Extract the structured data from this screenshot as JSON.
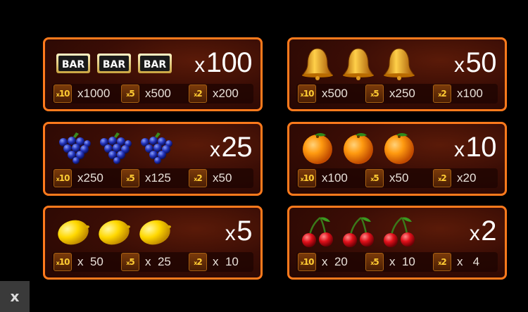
{
  "paytable": [
    {
      "symbol": "bar-icon",
      "multiplier": "100",
      "bonus": [
        {
          "badge": "10",
          "value": "x1000"
        },
        {
          "badge": "5",
          "value": "x500"
        },
        {
          "badge": "2",
          "value": "x200"
        }
      ]
    },
    {
      "symbol": "bell-icon",
      "multiplier": "50",
      "bonus": [
        {
          "badge": "10",
          "value": "x500"
        },
        {
          "badge": "5",
          "value": "x250"
        },
        {
          "badge": "2",
          "value": "x100"
        }
      ]
    },
    {
      "symbol": "grapes-icon",
      "multiplier": "25",
      "bonus": [
        {
          "badge": "10",
          "value": "x250"
        },
        {
          "badge": "5",
          "value": "x125"
        },
        {
          "badge": "2",
          "value": "x50"
        }
      ]
    },
    {
      "symbol": "orange-icon",
      "multiplier": "10",
      "bonus": [
        {
          "badge": "10",
          "value": "x100"
        },
        {
          "badge": "5",
          "value": "x50"
        },
        {
          "badge": "2",
          "value": "x20"
        }
      ]
    },
    {
      "symbol": "lemon-icon",
      "multiplier": "5",
      "bonus": [
        {
          "badge": "10",
          "value": "x  50"
        },
        {
          "badge": "5",
          "value": "x  25"
        },
        {
          "badge": "2",
          "value": "x  10"
        }
      ]
    },
    {
      "symbol": "cherry-icon",
      "multiplier": "2",
      "bonus": [
        {
          "badge": "10",
          "value": "x  20"
        },
        {
          "badge": "5",
          "value": "x  10"
        },
        {
          "badge": "2",
          "value": "x   4"
        }
      ]
    }
  ],
  "bar_label": "BAR",
  "x_prefix": "x",
  "close_label": "x",
  "colors": {
    "border": "#ff7a1c",
    "badge_text": "#ffcc33",
    "card_bg": "#3a0d05"
  }
}
